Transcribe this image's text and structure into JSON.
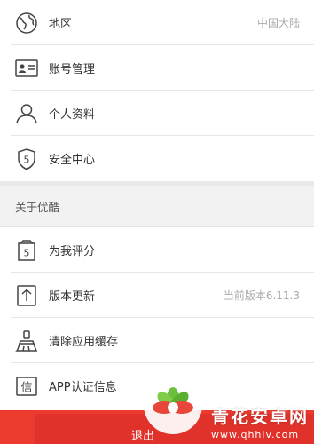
{
  "settings": {
    "items_top": [
      {
        "icon": "globe-icon",
        "label": "地区",
        "value": "中国大陆"
      },
      {
        "icon": "id-card-icon",
        "label": "账号管理",
        "value": ""
      },
      {
        "icon": "person-icon",
        "label": "个人资料",
        "value": ""
      },
      {
        "icon": "shield-icon",
        "label": "安全中心",
        "value": ""
      }
    ],
    "about_header": "关于优酷",
    "items_about": [
      {
        "icon": "rate-icon",
        "label": "为我评分",
        "value": ""
      },
      {
        "icon": "update-icon",
        "label": "版本更新",
        "value": "当前版本6.11.3"
      },
      {
        "icon": "broom-icon",
        "label": "清除应用缓存",
        "value": ""
      },
      {
        "icon": "certificate-icon",
        "label": "APP认证信息",
        "value": ""
      }
    ]
  },
  "logout": {
    "label": "退出"
  },
  "watermark": {
    "title": "青花安卓网",
    "url": "www.qhhlv.com"
  },
  "colors": {
    "accent_red": "#e0322a",
    "text": "#333333",
    "value_text": "#aaaaaa"
  }
}
